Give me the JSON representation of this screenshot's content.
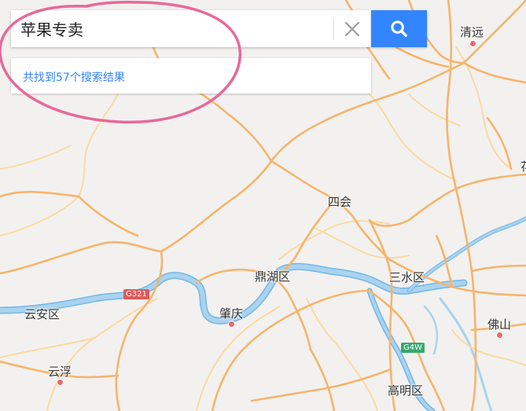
{
  "search": {
    "query": "苹果专卖"
  },
  "results": {
    "summary": "共找到57个搜索结果"
  },
  "places": [
    {
      "name": "清远"
    },
    {
      "name": "四会"
    },
    {
      "name": "鼎湖区"
    },
    {
      "name": "三水区"
    },
    {
      "name": "云安区"
    },
    {
      "name": "肇庆"
    },
    {
      "name": "佛山"
    },
    {
      "name": "云浮"
    },
    {
      "name": "高明区"
    },
    {
      "name": "花"
    }
  ],
  "road_shields": [
    {
      "code": "G321"
    },
    {
      "code": "G4W"
    }
  ],
  "colors": {
    "search_button": "#3385ff",
    "result_link": "#3385ff",
    "annotation_circle": "#e8689a",
    "road_major": "#f7b46b",
    "road_minor": "#fbd9a2",
    "river": "#a9d3ef",
    "river_edge": "#74b6e6",
    "map_background": "#f2f1ef",
    "city_dot": "#e66a6a",
    "shield_national": "#e0595a",
    "shield_expressway": "#36a96e"
  }
}
